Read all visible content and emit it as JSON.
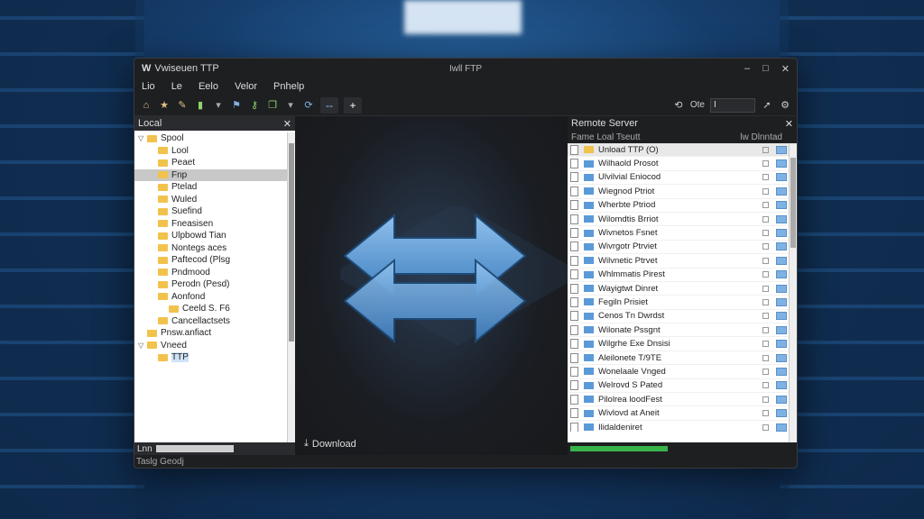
{
  "app": {
    "title": "Vwiseuen TTP",
    "center_title": "Iwll FTP"
  },
  "window_controls": {
    "minimize": "–",
    "maximize": "□",
    "close": "✕"
  },
  "menu": [
    "Lio",
    "Le",
    "Eelo",
    "Velor",
    "Pnhelp"
  ],
  "toolbar": {
    "icons": [
      "home-icon",
      "star-icon",
      "edit-icon",
      "bookmark-icon",
      "key-icon",
      "copy-icon",
      "sync-icon"
    ],
    "btn_collapse": "--",
    "btn_add": "+",
    "right_label": "Ote",
    "right_value": "I"
  },
  "left_pane": {
    "title": "Local",
    "close": "✕",
    "tree": [
      {
        "label": "Spool",
        "depth": 0,
        "twisty": "▽"
      },
      {
        "label": "Lool",
        "depth": 1
      },
      {
        "label": "Peaet",
        "depth": 1
      },
      {
        "label": "Fnp",
        "depth": 1,
        "selected": true
      },
      {
        "label": "Ptelad",
        "depth": 1
      },
      {
        "label": "Wuled",
        "depth": 1
      },
      {
        "label": "Suefind",
        "depth": 1
      },
      {
        "label": "Fneasisen",
        "depth": 1
      },
      {
        "label": "Ulpbowd Tian",
        "depth": 1
      },
      {
        "label": "Nontegs aces",
        "depth": 1
      },
      {
        "label": "Paftecod (Plsg",
        "depth": 1
      },
      {
        "label": "Pndmood",
        "depth": 1
      },
      {
        "label": "Perodn (Pesd)",
        "depth": 1
      },
      {
        "label": "Aonfond",
        "depth": 1
      },
      {
        "label": "Ceeld S. F6",
        "depth": 2
      },
      {
        "label": "Cancellactsets",
        "depth": 1
      },
      {
        "label": "Pnsw.anfiact",
        "depth": 0
      },
      {
        "label": "Vneed",
        "depth": 0,
        "twisty": "▽"
      },
      {
        "label": "TTP",
        "depth": 1
      }
    ],
    "footer_label": "Lnn"
  },
  "middle": {
    "download_label": "Download"
  },
  "right_pane": {
    "title": "Remote Server",
    "close": "✕",
    "col_name": "Fame  Loal Tseutt",
    "col_status": "lw Dlnntad",
    "rows": [
      {
        "name": "Unload TTP (O)",
        "type": "yellow"
      },
      {
        "name": "Wilhaold Prosot",
        "type": "blue"
      },
      {
        "name": "Ulvilvial Eniocod",
        "type": "blue"
      },
      {
        "name": "Wiegnod Ptriot",
        "type": "blue"
      },
      {
        "name": "Wherbte Ptriod",
        "type": "blue"
      },
      {
        "name": "Wilomdtis Brriot",
        "type": "blue"
      },
      {
        "name": "Wivnetos Fsnet",
        "type": "blue"
      },
      {
        "name": "Wivrgotr Ptrviet",
        "type": "blue"
      },
      {
        "name": "Wilvnetic Ptrvet",
        "type": "blue"
      },
      {
        "name": "Whlmmatis Pirest",
        "type": "blue"
      },
      {
        "name": "Wayigtwt Dinret",
        "type": "blue"
      },
      {
        "name": "Fegiln Prisiet",
        "type": "blue"
      },
      {
        "name": "Cenos Tn Dwrdst",
        "type": "blue"
      },
      {
        "name": "Wilonate Pssgnt",
        "type": "blue"
      },
      {
        "name": "Wilgrhe Exe Dnsisi",
        "type": "blue"
      },
      {
        "name": "Aleilonete T/9TE",
        "type": "blue"
      },
      {
        "name": "Wonelaale Vnged",
        "type": "blue"
      },
      {
        "name": "Welrovd S Pated",
        "type": "blue"
      },
      {
        "name": "Pilolrea loodFest",
        "type": "blue"
      },
      {
        "name": "Wivlovd at Aneit",
        "type": "blue"
      },
      {
        "name": "Ilidaldeniret",
        "type": "blue"
      }
    ],
    "progress_fraction": 0.43
  },
  "status": "Taslg Geodj"
}
